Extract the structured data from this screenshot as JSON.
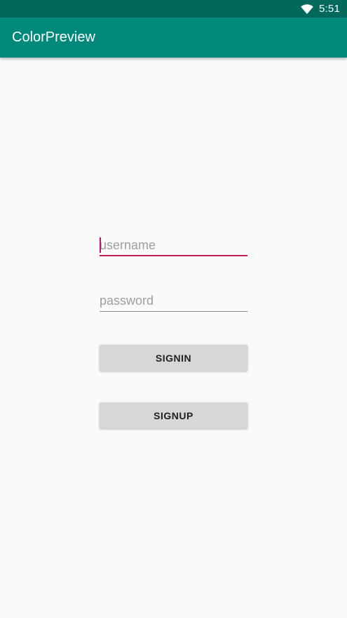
{
  "status_bar": {
    "time": "5:51",
    "wifi_icon": "wifi-icon"
  },
  "app_bar": {
    "title": "ColorPreview"
  },
  "form": {
    "username": {
      "placeholder": "username",
      "value": ""
    },
    "password": {
      "placeholder": "password",
      "value": ""
    },
    "signin_label": "SIGNIN",
    "signup_label": "SIGNUP"
  },
  "colors": {
    "status_bar": "#00695c",
    "app_bar": "#00897b",
    "accent": "#c2185b",
    "background": "#fafafa",
    "button": "#d6d7d7"
  }
}
